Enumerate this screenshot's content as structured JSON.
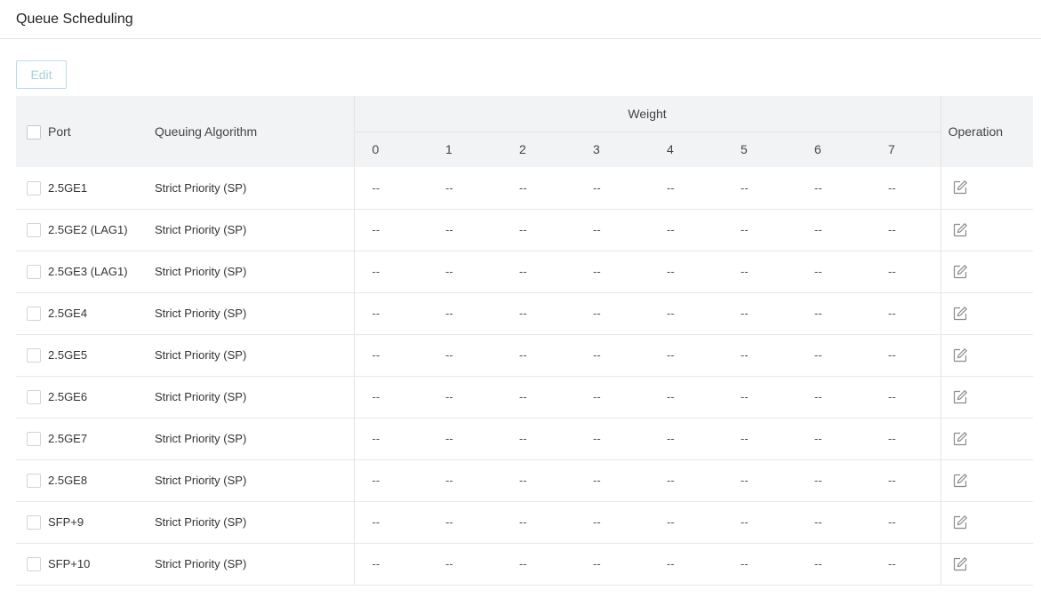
{
  "page": {
    "title": "Queue Scheduling"
  },
  "toolbar": {
    "edit_label": "Edit"
  },
  "table": {
    "headers": {
      "port": "Port",
      "algorithm": "Queuing Algorithm",
      "weight": "Weight",
      "weight_cols": [
        "0",
        "1",
        "2",
        "3",
        "4",
        "5",
        "6",
        "7"
      ],
      "operation": "Operation"
    },
    "rows": [
      {
        "port": "2.5GE1",
        "algorithm": "Strict Priority (SP)",
        "weights": [
          "--",
          "--",
          "--",
          "--",
          "--",
          "--",
          "--",
          "--"
        ]
      },
      {
        "port": "2.5GE2 (LAG1)",
        "algorithm": "Strict Priority (SP)",
        "weights": [
          "--",
          "--",
          "--",
          "--",
          "--",
          "--",
          "--",
          "--"
        ]
      },
      {
        "port": "2.5GE3 (LAG1)",
        "algorithm": "Strict Priority (SP)",
        "weights": [
          "--",
          "--",
          "--",
          "--",
          "--",
          "--",
          "--",
          "--"
        ]
      },
      {
        "port": "2.5GE4",
        "algorithm": "Strict Priority (SP)",
        "weights": [
          "--",
          "--",
          "--",
          "--",
          "--",
          "--",
          "--",
          "--"
        ]
      },
      {
        "port": "2.5GE5",
        "algorithm": "Strict Priority (SP)",
        "weights": [
          "--",
          "--",
          "--",
          "--",
          "--",
          "--",
          "--",
          "--"
        ]
      },
      {
        "port": "2.5GE6",
        "algorithm": "Strict Priority (SP)",
        "weights": [
          "--",
          "--",
          "--",
          "--",
          "--",
          "--",
          "--",
          "--"
        ]
      },
      {
        "port": "2.5GE7",
        "algorithm": "Strict Priority (SP)",
        "weights": [
          "--",
          "--",
          "--",
          "--",
          "--",
          "--",
          "--",
          "--"
        ]
      },
      {
        "port": "2.5GE8",
        "algorithm": "Strict Priority (SP)",
        "weights": [
          "--",
          "--",
          "--",
          "--",
          "--",
          "--",
          "--",
          "--"
        ]
      },
      {
        "port": "SFP+9",
        "algorithm": "Strict Priority (SP)",
        "weights": [
          "--",
          "--",
          "--",
          "--",
          "--",
          "--",
          "--",
          "--"
        ]
      },
      {
        "port": "SFP+10",
        "algorithm": "Strict Priority (SP)",
        "weights": [
          "--",
          "--",
          "--",
          "--",
          "--",
          "--",
          "--",
          "--"
        ]
      }
    ],
    "row_action_icon": "edit-icon"
  },
  "colors": {
    "header_bg": "#f2f3f5",
    "edit_button_border": "#b9dbe6",
    "edit_button_text": "#a8cfd9"
  }
}
